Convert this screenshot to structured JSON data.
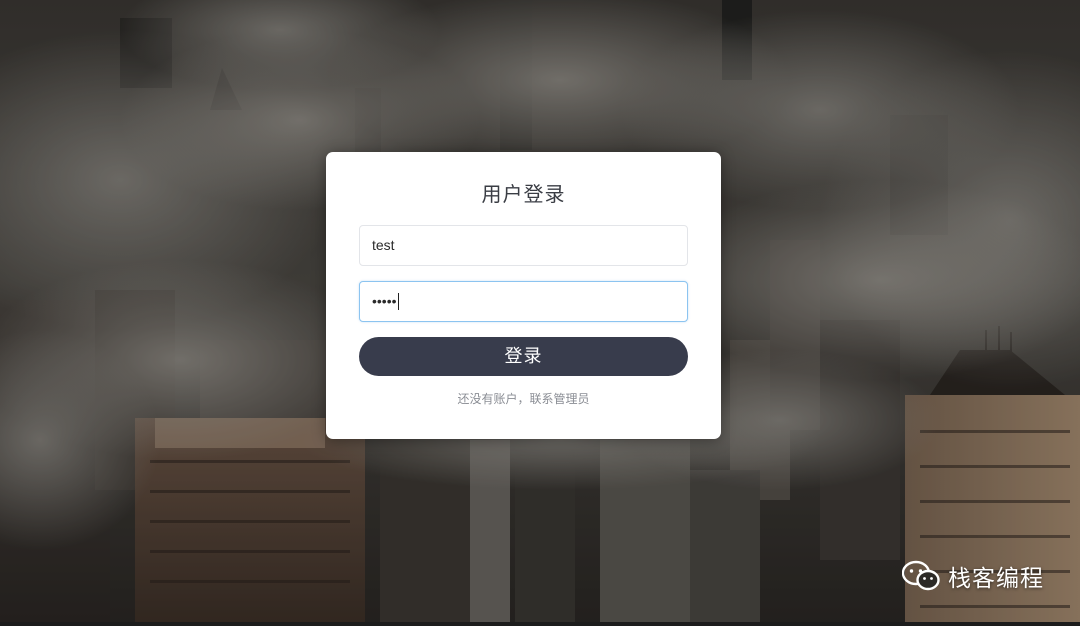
{
  "login": {
    "title": "用户登录",
    "username_value": "test",
    "password_value": "•••••",
    "submit_label": "登录",
    "register_hint": "还没有账户，联系管理员"
  },
  "watermark": {
    "text": "栈客编程"
  },
  "colors": {
    "button_bg": "#383c4c",
    "card_bg": "#ffffff",
    "focus_border": "#8cc4f0"
  }
}
